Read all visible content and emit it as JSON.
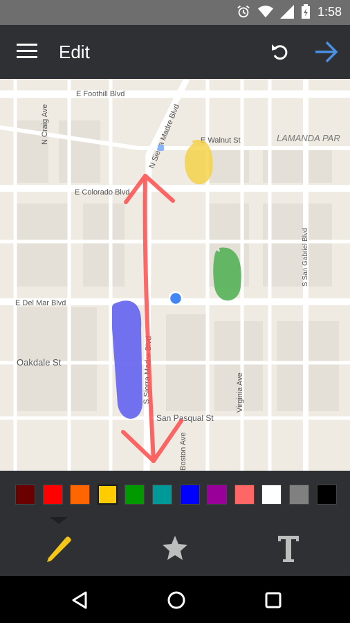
{
  "status": {
    "time": "1:58"
  },
  "toolbar": {
    "title": "Edit"
  },
  "map": {
    "streets": {
      "foothill": "E Foothill Blvd",
      "craig": "N Craig Ave",
      "sierra_madre_n": "N Sierra Madre Blvd",
      "walnut": "E Walnut St",
      "lamanda": "LAMANDA PAR",
      "colorado": "E Colorado Blvd",
      "san_gabriel": "S San Gabriel Blvd",
      "del_mar": "E Del Mar Blvd",
      "sierra_madre_s": "S Sierra Madre Blvd",
      "oakdale": "Oakdale St",
      "virginia": "Virginia Ave",
      "san_pasqual": "San Pasqual St",
      "boston": "Boston Ave"
    }
  },
  "palette": {
    "colors": [
      "#6b0000",
      "#ff0000",
      "#ff6600",
      "#ffcc00",
      "#009900",
      "#009999",
      "#0000ff",
      "#990099",
      "#ff6666",
      "#ffffff",
      "#808080",
      "#000000"
    ],
    "selected_index": 3
  },
  "tabs": [
    {
      "icon": "pencil-icon",
      "active": true
    },
    {
      "icon": "star-icon",
      "active": false
    },
    {
      "icon": "text-icon",
      "active": false
    }
  ],
  "colors": {
    "accent_arrow": "#4a90e2",
    "pencil": "#f5c518",
    "toolbar": "#2f3033"
  }
}
